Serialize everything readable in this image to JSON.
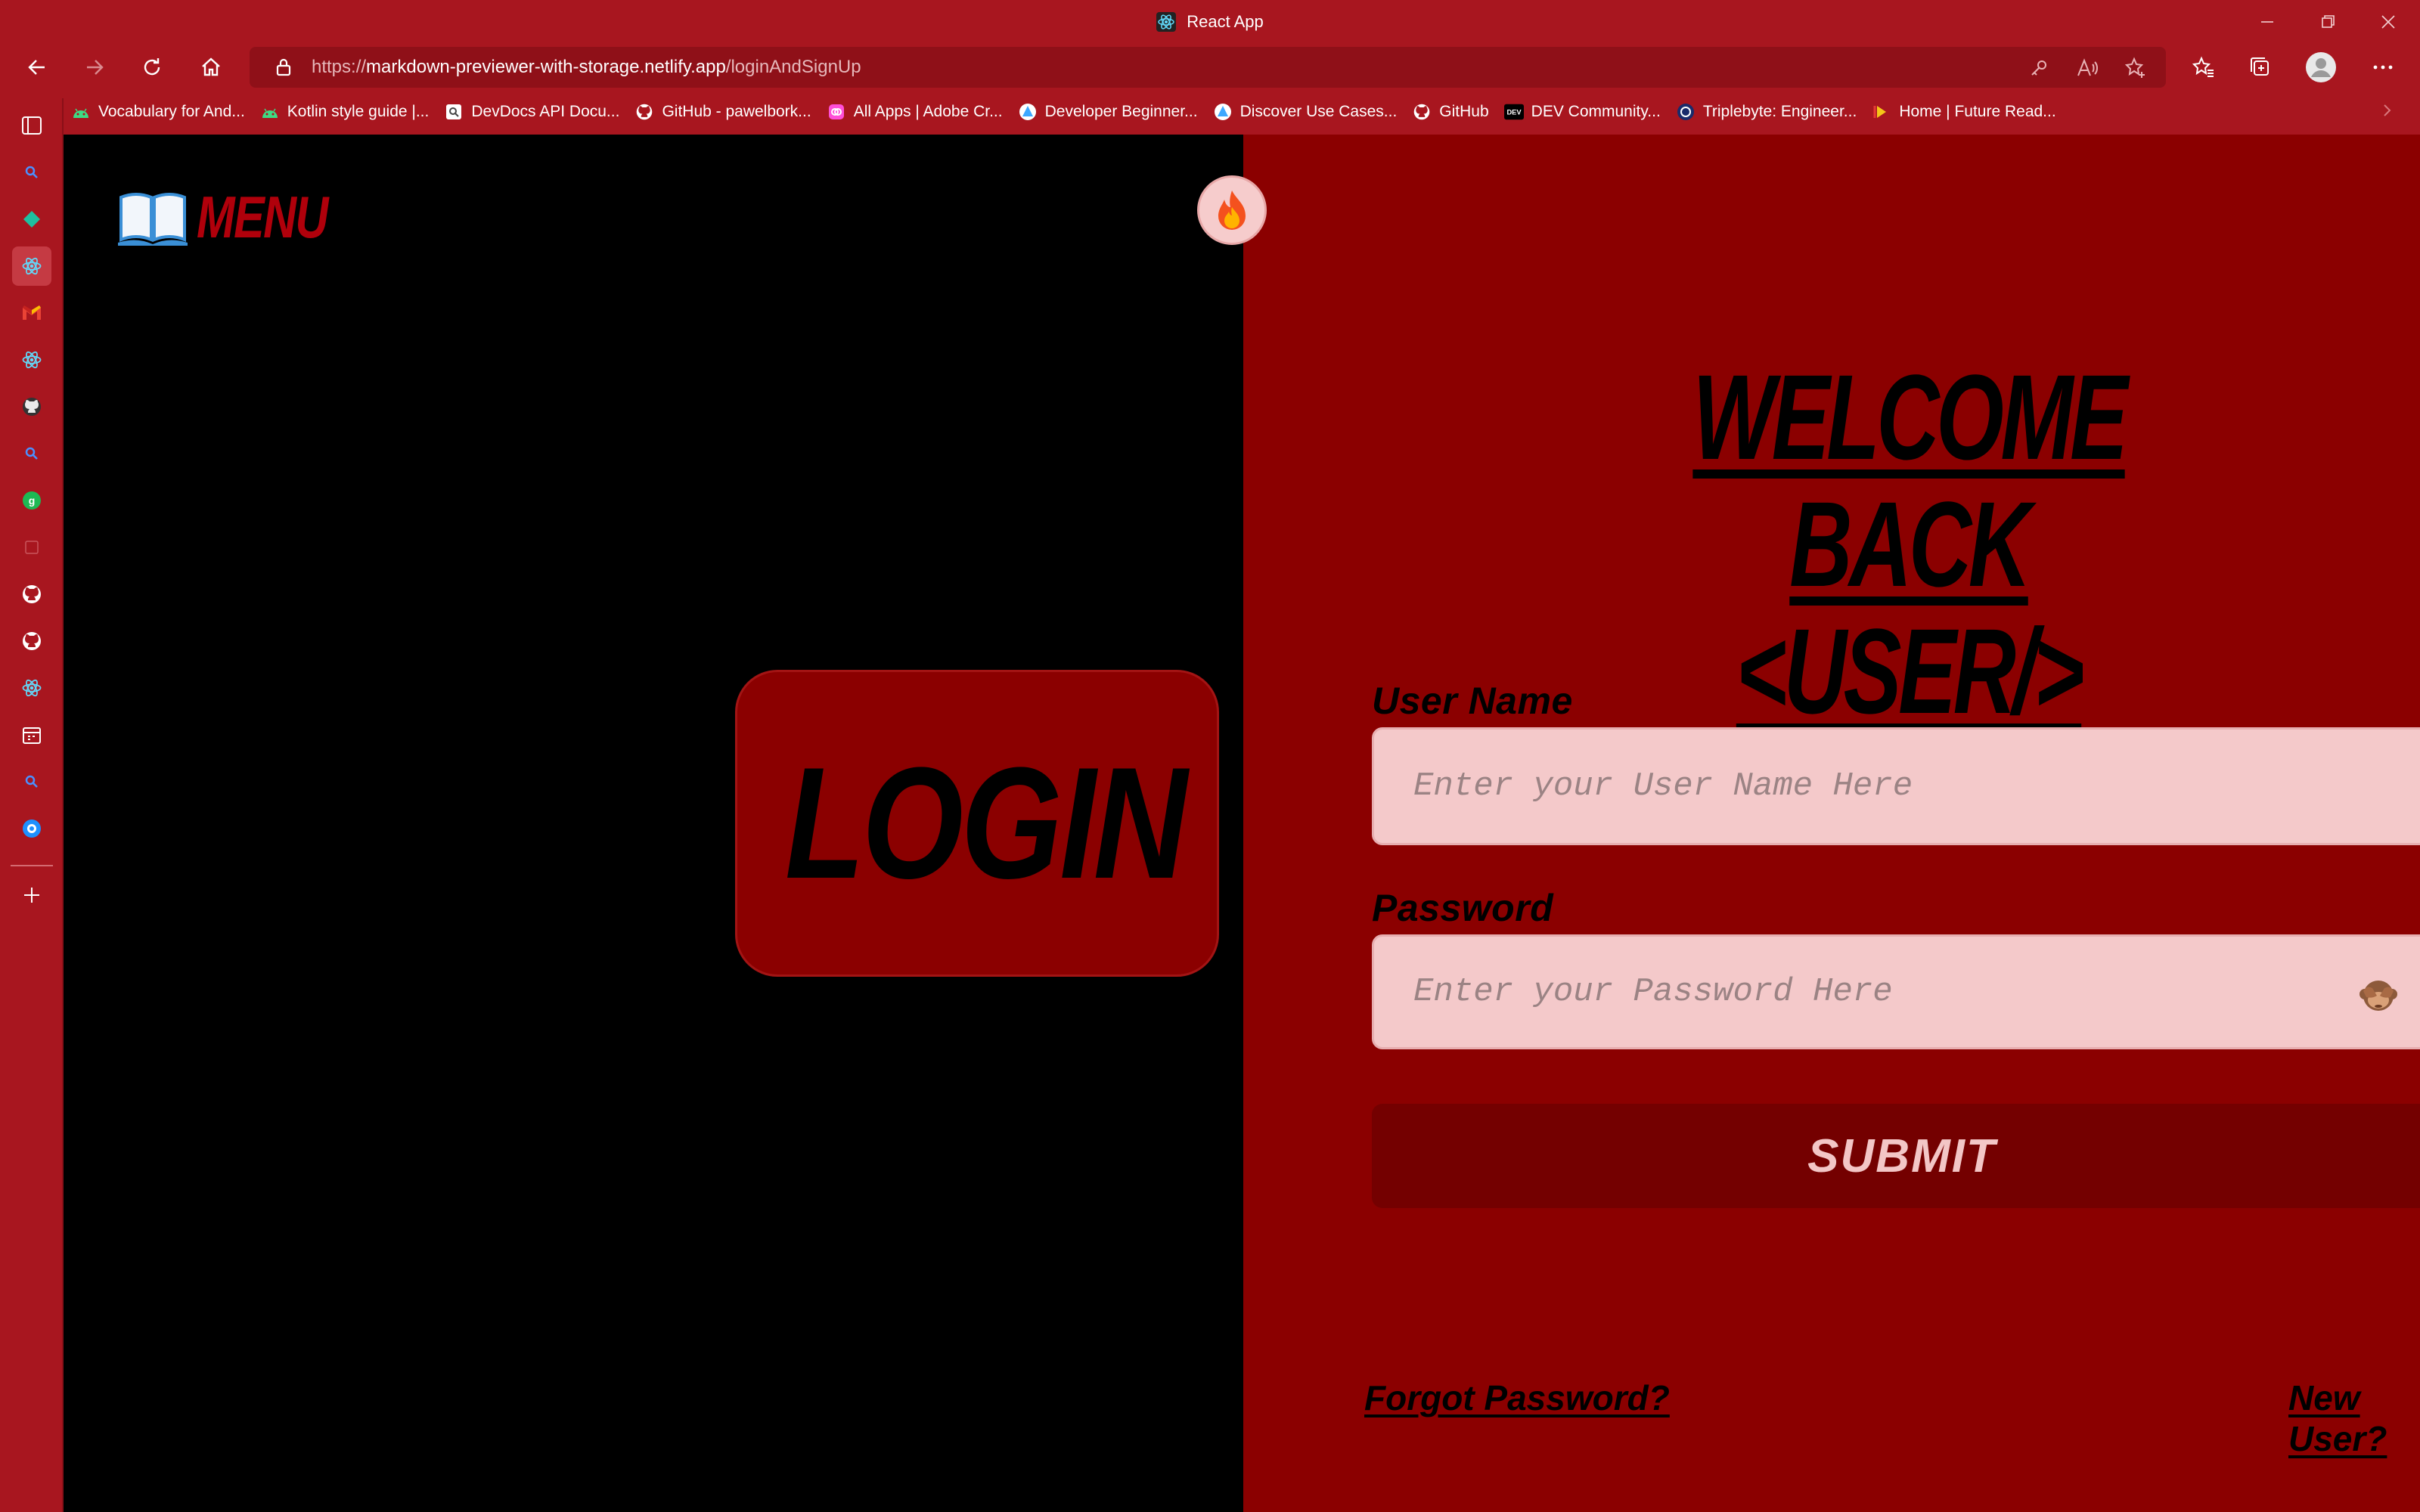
{
  "browser": {
    "window_title": "React App",
    "url_scheme": "https://",
    "url_host": "markdown-previewer-with-storage.netlify.app",
    "url_path": "/loginAndSignUp",
    "bookmarks": [
      {
        "label": "Vocabulary for And...",
        "icon": "android-icon",
        "color": "#3ddc84"
      },
      {
        "label": "Kotlin style guide |...",
        "icon": "android-icon",
        "color": "#3ddc84"
      },
      {
        "label": "DevDocs API Docu...",
        "icon": "devdocs-icon",
        "color": "#ffffff"
      },
      {
        "label": "GitHub - pawelbork...",
        "icon": "github-icon",
        "color": "#ffffff"
      },
      {
        "label": "All Apps | Adobe Cr...",
        "icon": "adobe-cc-icon",
        "color": "#ff4fd8"
      },
      {
        "label": "Developer Beginner...",
        "icon": "azure-icon",
        "color": "#3da8ff"
      },
      {
        "label": "Discover Use Cases...",
        "icon": "azure-icon",
        "color": "#3da8ff"
      },
      {
        "label": "GitHub",
        "icon": "github-icon",
        "color": "#ffffff"
      },
      {
        "label": "DEV Community...",
        "icon": "dev-icon",
        "color": "#000000"
      },
      {
        "label": "Triplebyte: Engineer...",
        "icon": "triplebyte-icon",
        "color": "#1a2b6b"
      },
      {
        "label": "Home | Future Read...",
        "icon": "future-icon",
        "color": "#f5c518"
      }
    ]
  },
  "app": {
    "menu_label": "MENU",
    "login_tab_label": "LOGIN",
    "welcome_line1": "WELCOME BACK",
    "welcome_line2": "<USER/>",
    "username_label": "User Name",
    "username_placeholder": "Enter your User Name Here",
    "password_label": "Password",
    "password_placeholder": "Enter your Password Here",
    "submit_label": "SUBMIT",
    "forgot_password_label": "Forgot Password?",
    "new_user_label": "New User?"
  },
  "colors": {
    "chrome": "#a8161f",
    "panel_red": "#8b0000",
    "submit_red": "#740000",
    "input_bg": "#f4c9ca"
  }
}
